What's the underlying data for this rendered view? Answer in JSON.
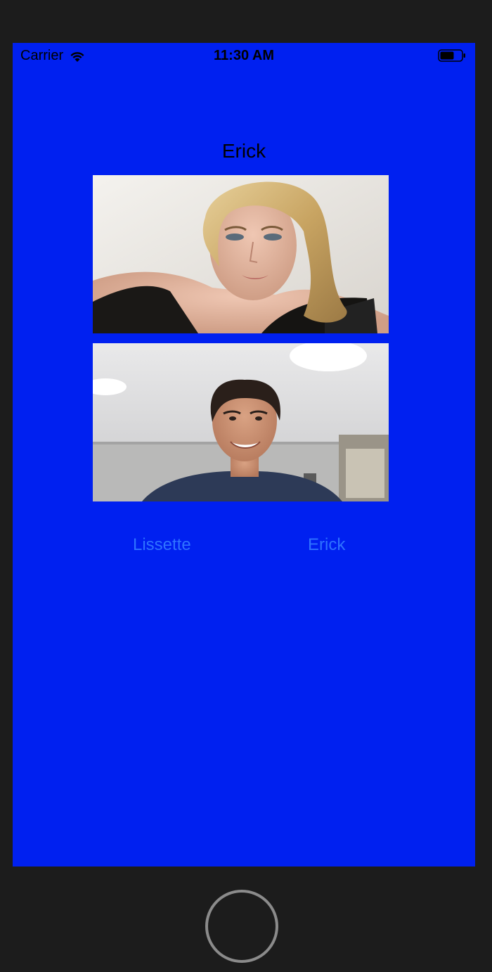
{
  "status_bar": {
    "carrier": "Carrier",
    "time": "11:30 AM",
    "wifi_icon": "wifi-icon",
    "battery_icon": "battery-icon"
  },
  "main": {
    "title": "Erick",
    "photos": [
      {
        "name": "woman-portrait-photo"
      },
      {
        "name": "man-selfie-photo"
      }
    ],
    "buttons": [
      {
        "label": "Lissette"
      },
      {
        "label": "Erick"
      }
    ]
  },
  "device": {
    "home_button_icon": "home-button-icon"
  },
  "colors": {
    "screen_background": "#0020f0",
    "button_text": "#2f73ff",
    "bezel": "#1c1c1c"
  }
}
